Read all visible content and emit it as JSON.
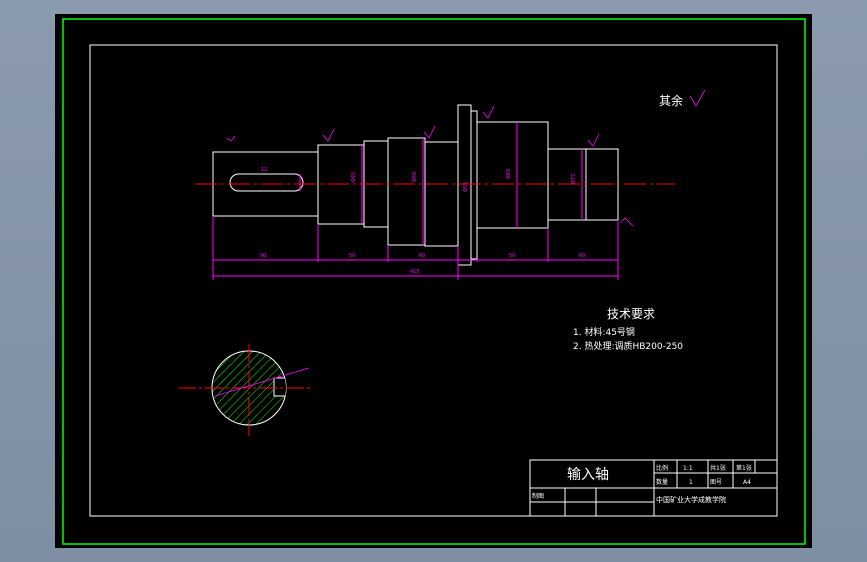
{
  "drawing": {
    "roughness_note": "其余",
    "tech_requirements": {
      "heading": "技术要求",
      "items": [
        "1. 材料:45号钢",
        "2. 热处理:调质HB200-250"
      ]
    },
    "dimensions": {
      "overall_length": "415",
      "segment_1": "90",
      "segment_2": "50",
      "segment_3": "60",
      "segment_4": "50",
      "segment_5": "60",
      "keyway_width": "12",
      "dia_1": "Φ45",
      "dia_2": "Φ55",
      "dia_3": "Φ65",
      "dia_4": "Φ75",
      "dia_5": "Φ55"
    }
  },
  "title_block": {
    "part_name": "输入轴",
    "scale_label": "比例",
    "scale_value": "1:1",
    "sheet_label": "共1张",
    "sheet_no": "第1张",
    "qty_label": "数量",
    "qty_value": "1",
    "drawing_no_label": "图号",
    "drawing_no_value": "A4",
    "drafter_label": "制图",
    "school": "中国矿业大学成教学院"
  },
  "colors": {
    "frame": "#00ff00",
    "magenta": "#ff00ff",
    "red": "#ff0000",
    "white": "#ffffff",
    "hatch": "#00ff00"
  }
}
